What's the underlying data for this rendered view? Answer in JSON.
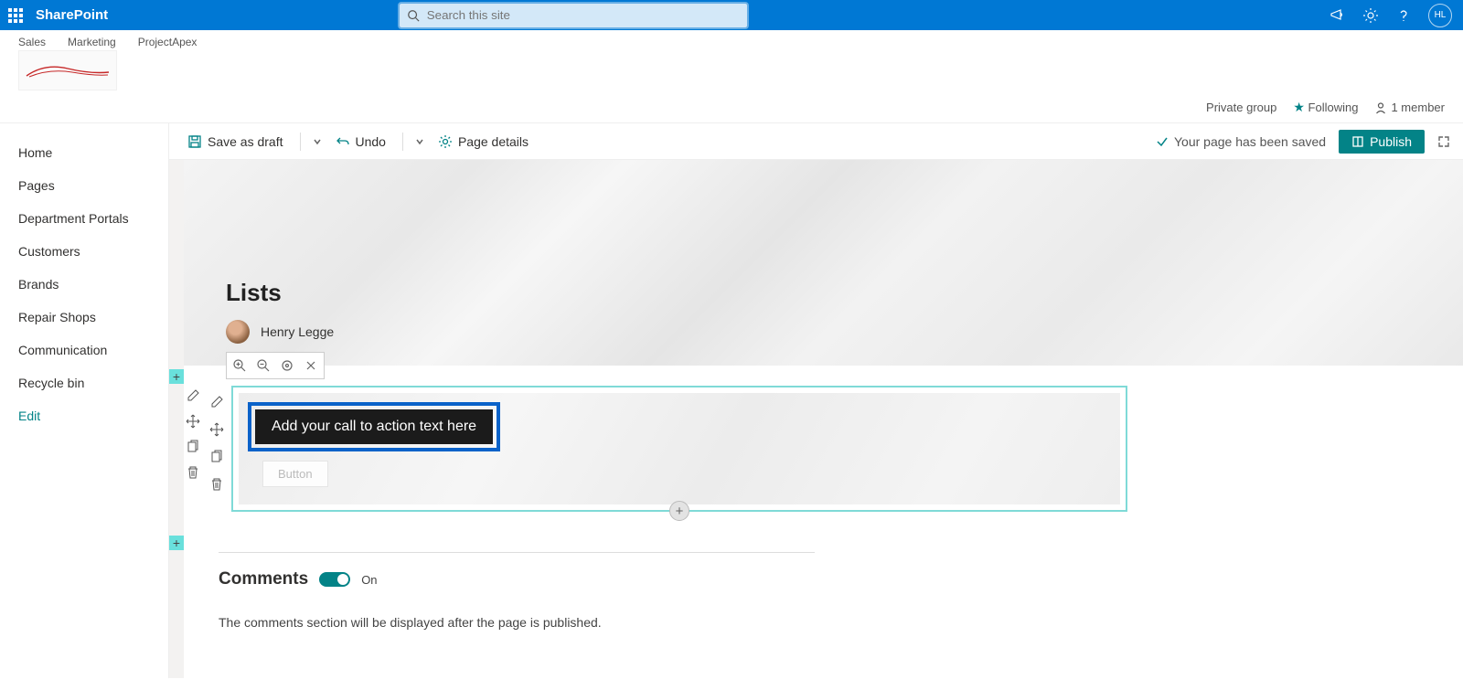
{
  "suite": {
    "brand": "SharePoint",
    "search_placeholder": "Search this site",
    "avatar_initials": "HL"
  },
  "site_nav": {
    "links": [
      "Sales",
      "Marketing",
      "ProjectApex"
    ]
  },
  "site_info": {
    "privacy": "Private group",
    "following": "Following",
    "members": "1 member"
  },
  "commandbar": {
    "save_draft": "Save as draft",
    "undo": "Undo",
    "page_details": "Page details",
    "saved_msg": "Your page has been saved",
    "publish": "Publish"
  },
  "left_nav": {
    "items": [
      {
        "label": "Home",
        "chevron": false
      },
      {
        "label": "Pages",
        "chevron": true
      },
      {
        "label": "Department Portals",
        "chevron": true
      },
      {
        "label": "Customers",
        "chevron": false
      },
      {
        "label": "Brands",
        "chevron": false
      },
      {
        "label": "Repair Shops",
        "chevron": false
      },
      {
        "label": "Communication",
        "chevron": false
      },
      {
        "label": "Recycle bin",
        "chevron": false
      }
    ],
    "edit": "Edit"
  },
  "hero": {
    "title": "Lists",
    "author": "Henry Legge"
  },
  "cta": {
    "placeholder": "Add your call to action text here",
    "button_label": "Button"
  },
  "comments": {
    "heading": "Comments",
    "toggle_state": "On",
    "note": "The comments section will be displayed after the page is published."
  }
}
